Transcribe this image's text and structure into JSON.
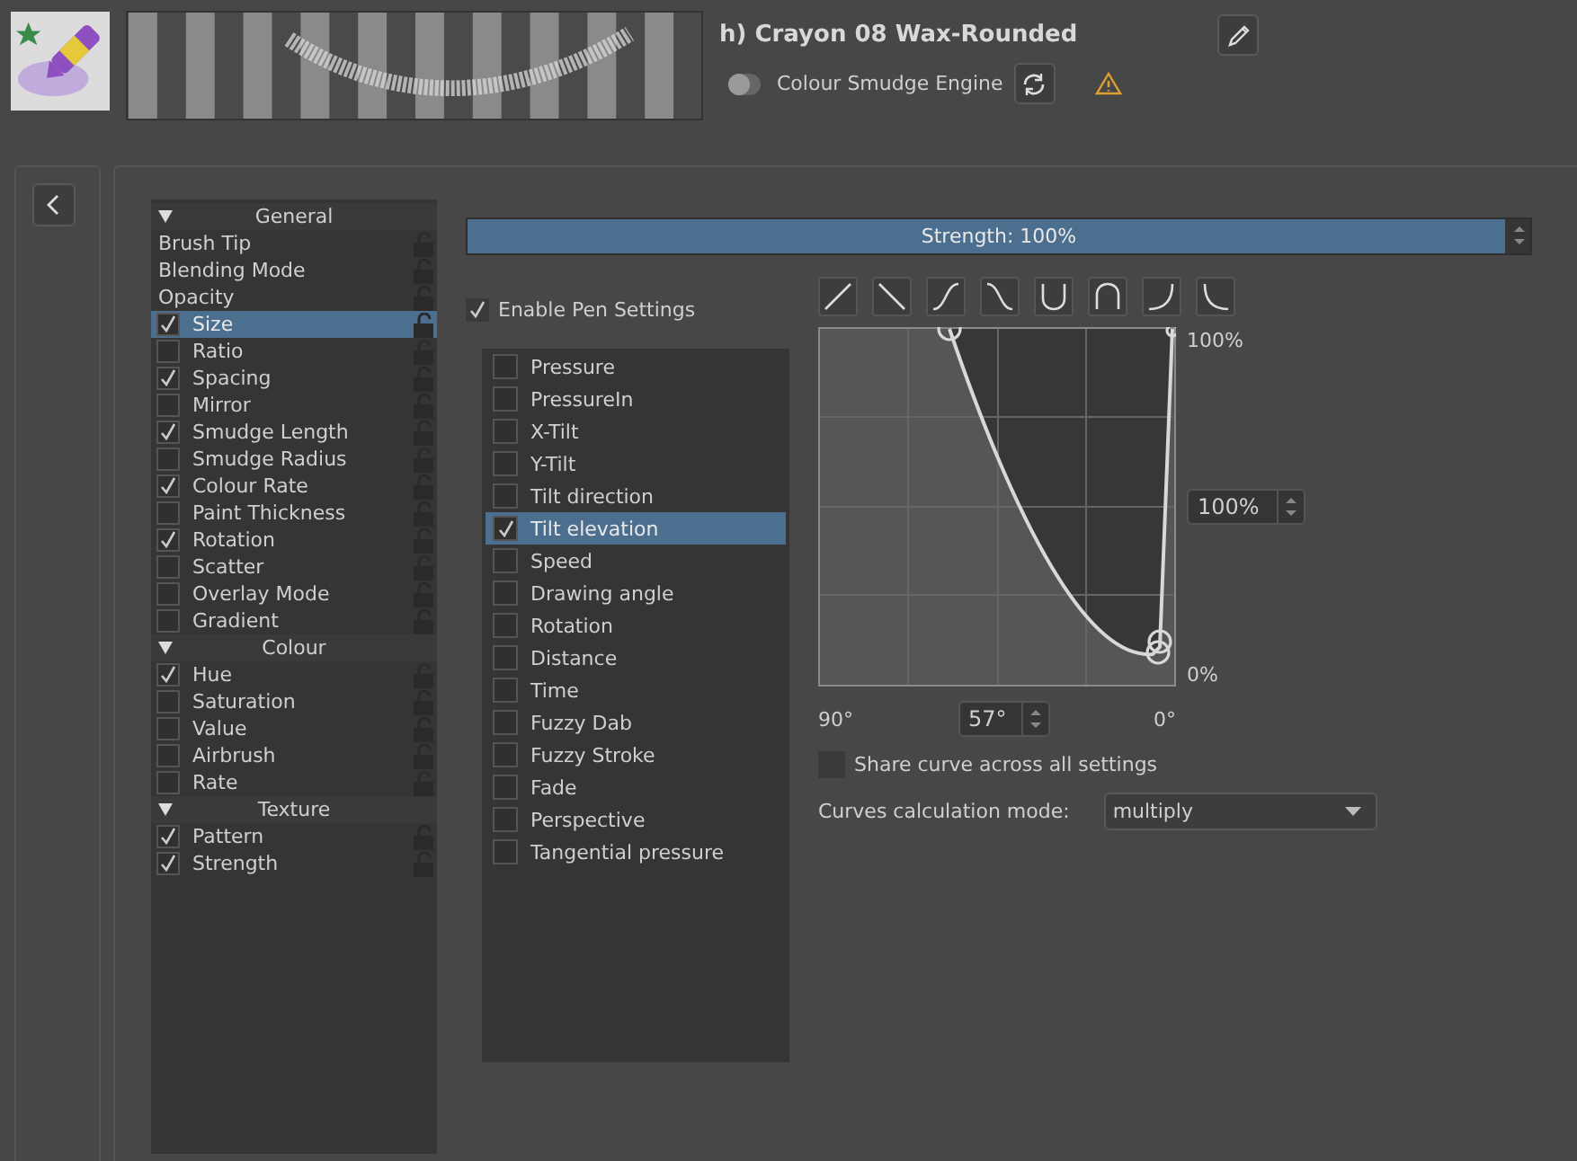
{
  "header": {
    "preset_name": "h) Crayon 08 Wax-Rounded",
    "engine": "Colour Smudge Engine",
    "engine_toggle_on": false
  },
  "option_groups": [
    {
      "title": "General",
      "expanded": true,
      "items": [
        {
          "label": "Brush Tip",
          "kind": "plain",
          "selected": false
        },
        {
          "label": "Blending Mode",
          "kind": "plain",
          "selected": false
        },
        {
          "label": "Opacity",
          "kind": "plain",
          "selected": false
        },
        {
          "label": "Size",
          "kind": "check",
          "checked": true,
          "selected": true
        },
        {
          "label": "Ratio",
          "kind": "check",
          "checked": false,
          "selected": false
        },
        {
          "label": "Spacing",
          "kind": "check",
          "checked": true,
          "selected": false
        },
        {
          "label": "Mirror",
          "kind": "check",
          "checked": false,
          "selected": false
        },
        {
          "label": "Smudge Length",
          "kind": "check",
          "checked": true,
          "selected": false
        },
        {
          "label": "Smudge Radius",
          "kind": "check",
          "checked": false,
          "selected": false
        },
        {
          "label": "Colour Rate",
          "kind": "check",
          "checked": true,
          "selected": false
        },
        {
          "label": "Paint Thickness",
          "kind": "check",
          "checked": false,
          "selected": false
        },
        {
          "label": "Rotation",
          "kind": "check",
          "checked": true,
          "selected": false
        },
        {
          "label": "Scatter",
          "kind": "check",
          "checked": false,
          "selected": false
        },
        {
          "label": "Overlay Mode",
          "kind": "check",
          "checked": false,
          "selected": false
        },
        {
          "label": "Gradient",
          "kind": "check",
          "checked": false,
          "selected": false
        }
      ]
    },
    {
      "title": "Colour",
      "expanded": true,
      "items": [
        {
          "label": "Hue",
          "kind": "check",
          "checked": true,
          "selected": false
        },
        {
          "label": "Saturation",
          "kind": "check",
          "checked": false,
          "selected": false
        },
        {
          "label": "Value",
          "kind": "check",
          "checked": false,
          "selected": false
        },
        {
          "label": "Airbrush",
          "kind": "check",
          "checked": false,
          "selected": false
        },
        {
          "label": "Rate",
          "kind": "check",
          "checked": false,
          "selected": false
        }
      ]
    },
    {
      "title": "Texture",
      "expanded": true,
      "items": [
        {
          "label": "Pattern",
          "kind": "check",
          "checked": true,
          "selected": false
        },
        {
          "label": "Strength",
          "kind": "check",
          "checked": true,
          "selected": false
        }
      ]
    }
  ],
  "strength_slider": {
    "text": "Strength: 100%",
    "level": 1.0
  },
  "enable_pen_settings": {
    "label": "Enable Pen Settings",
    "checked": true
  },
  "sensors": [
    {
      "label": "Pressure",
      "checked": false,
      "selected": false
    },
    {
      "label": "PressureIn",
      "checked": false,
      "selected": false
    },
    {
      "label": "X-Tilt",
      "checked": false,
      "selected": false
    },
    {
      "label": "Y-Tilt",
      "checked": false,
      "selected": false
    },
    {
      "label": "Tilt direction",
      "checked": false,
      "selected": false
    },
    {
      "label": "Tilt elevation",
      "checked": true,
      "selected": true
    },
    {
      "label": "Speed",
      "checked": false,
      "selected": false
    },
    {
      "label": "Drawing angle",
      "checked": false,
      "selected": false
    },
    {
      "label": "Rotation",
      "checked": false,
      "selected": false
    },
    {
      "label": "Distance",
      "checked": false,
      "selected": false
    },
    {
      "label": "Time",
      "checked": false,
      "selected": false
    },
    {
      "label": "Fuzzy Dab",
      "checked": false,
      "selected": false
    },
    {
      "label": "Fuzzy Stroke",
      "checked": false,
      "selected": false
    },
    {
      "label": "Fade",
      "checked": false,
      "selected": false
    },
    {
      "label": "Perspective",
      "checked": false,
      "selected": false
    },
    {
      "label": "Tangential pressure",
      "checked": false,
      "selected": false
    }
  ],
  "curve_presets": [
    {
      "kind": "linear-up"
    },
    {
      "kind": "linear-down"
    },
    {
      "kind": "s-up"
    },
    {
      "kind": "s-down"
    },
    {
      "kind": "cup"
    },
    {
      "kind": "cap"
    },
    {
      "kind": "ease-up"
    },
    {
      "kind": "ease-down"
    }
  ],
  "curve": {
    "y_max_label": "100%",
    "y_min_label": "0%",
    "y_value": "100%",
    "x_max_label": "90°",
    "x_value": "57°",
    "x_min_label": "0°"
  },
  "share_curve": {
    "label": "Share curve across all settings",
    "checked": false
  },
  "calc_mode": {
    "label": "Curves calculation mode:",
    "value": "multiply"
  }
}
